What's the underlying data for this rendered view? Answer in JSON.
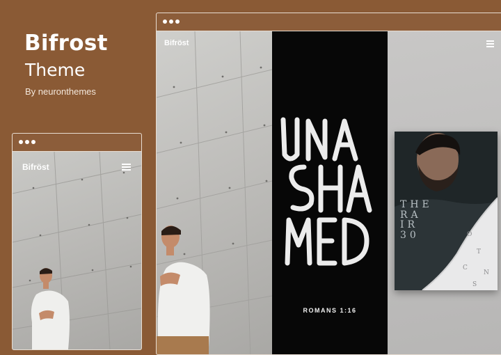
{
  "promo": {
    "title": "Bifrost",
    "subtitle": "Theme",
    "author": "By neuronthemes"
  },
  "mobile_preview": {
    "brand": "Bifröst"
  },
  "desktop_preview": {
    "brand": "Bifröst",
    "poster_verse": "ROMANS 1:16",
    "album_lines": [
      "THE",
      "RA",
      "IR",
      "30"
    ]
  },
  "colors": {
    "background": "#8a5a35",
    "frame_bar": "#8c5d3a",
    "poster": "#070707"
  }
}
